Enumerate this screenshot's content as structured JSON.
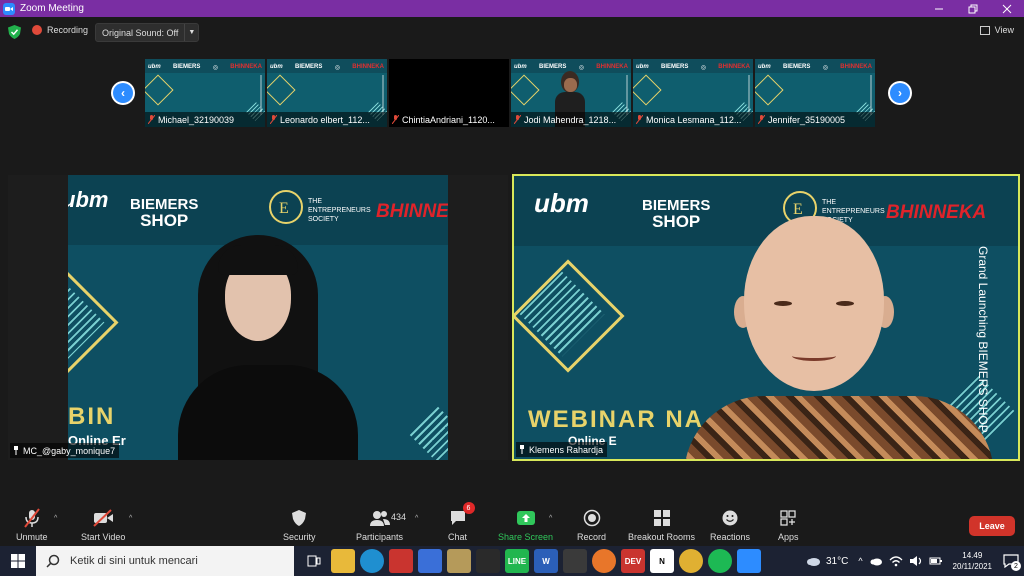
{
  "window": {
    "title": "Zoom Meeting"
  },
  "topbar": {
    "recording_label": "Recording",
    "original_sound_label": "Original Sound: Off",
    "view_label": "View"
  },
  "strip": {
    "thumbnails": [
      {
        "name": "Michael_32190039",
        "video": "background",
        "muted": true
      },
      {
        "name": "Leonardo elbert_112...",
        "video": "background",
        "muted": true
      },
      {
        "name": "ChintiaAndriani_1120...",
        "video": "off",
        "muted": true
      },
      {
        "name": "Jodi Mahendra_1218...",
        "video": "person",
        "muted": true
      },
      {
        "name": "Monica Lesmana_112...",
        "video": "background",
        "muted": true
      },
      {
        "name": "Jennifer_35190005",
        "video": "background",
        "muted": true
      }
    ]
  },
  "backdrop": {
    "logo_ubm": "ubm",
    "logo_biemers_1": "BIEMERS",
    "logo_biemers_2": "SHOP",
    "logo_society": "THE ENTREPRENEURS SOCIETY",
    "logo_bhinneka": "BHINNEKA",
    "left_text": "BIN",
    "left_sub": "Online Er",
    "right_text": "WEBINAR NA",
    "right_sub": "Online E",
    "vertical_text": "Grand Launching BIEMERS SHOP"
  },
  "videos": {
    "left_name": "MC_@gaby_monique7",
    "right_name": "Klemens Rahardja"
  },
  "toolbar": {
    "unmute": "Unmute",
    "start_video": "Start Video",
    "security": "Security",
    "participants": "Participants",
    "participants_count": "434",
    "chat": "Chat",
    "chat_badge": "6",
    "share_screen": "Share Screen",
    "record": "Record",
    "breakout_rooms": "Breakout Rooms",
    "reactions": "Reactions",
    "apps": "Apps",
    "leave": "Leave"
  },
  "taskbar": {
    "search_placeholder": "Ketik di sini untuk mencari",
    "temperature": "31°C",
    "time": "14.49",
    "date": "20/11/2021",
    "notification_count": "2"
  },
  "colors": {
    "title_bar": "#7a2ea3",
    "active_speaker_border": "#d8e85a",
    "leave_button": "#d1342a",
    "share_screen": "#30c75b",
    "nav_arrow": "#2d8cff"
  }
}
